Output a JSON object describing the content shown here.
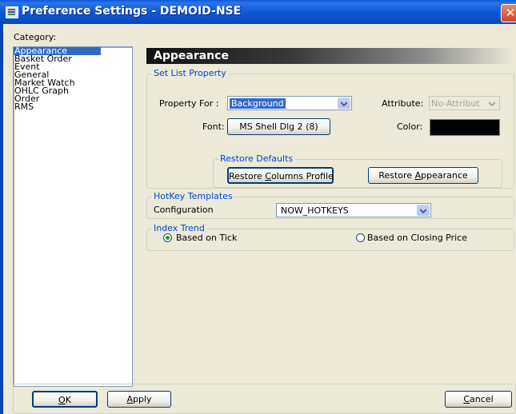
{
  "window": {
    "title": "Preference Settings - DEMOID-NSE",
    "close_glyph": "✕"
  },
  "category": {
    "label": "Category:",
    "items": [
      "Appearance",
      "Basket Order",
      "Event",
      "General",
      "Market Watch",
      "OHLC Graph",
      "Order",
      "RMS"
    ],
    "selected": "Appearance"
  },
  "panel": {
    "heading": "Appearance"
  },
  "set_list_property": {
    "legend": "Set List Property",
    "property_for_label": "Property For :",
    "property_for_value": "Background",
    "attribute_label": "Attribute:",
    "attribute_value": "No-Attribut",
    "font_label": "Font:",
    "font_button": "MS Shell Dlg 2 (8)",
    "color_label": "Color:",
    "color_value": "#000000"
  },
  "restore_defaults": {
    "legend": "Restore Defaults",
    "columns_btn_pre": "Restore ",
    "columns_btn_key": "C",
    "columns_btn_post": "olumns Profile",
    "appearance_btn_pre": "Restore ",
    "appearance_btn_key": "A",
    "appearance_btn_post": "ppearance"
  },
  "hotkey": {
    "legend": "HotKey Templates",
    "config_label": "Configuration",
    "config_value": "NOW_HOTKEYS"
  },
  "index_trend": {
    "legend": "Index Trend",
    "option_tick": "Based on Tick",
    "option_closing": "Based on Closing Price",
    "selected": "tick"
  },
  "footer": {
    "ok_key": "O",
    "ok_rest": "K",
    "apply_key": "A",
    "apply_rest": "pply",
    "cancel_key": "C",
    "cancel_rest": "ancel"
  },
  "colors": {
    "title_bar": "#0a5ad8",
    "accent_legend": "#0046d5",
    "selection": "#316ac5",
    "dialog_bg": "#ece9d8"
  },
  "icons": [
    "app-icon",
    "close-icon",
    "chevron-down-icon"
  ]
}
